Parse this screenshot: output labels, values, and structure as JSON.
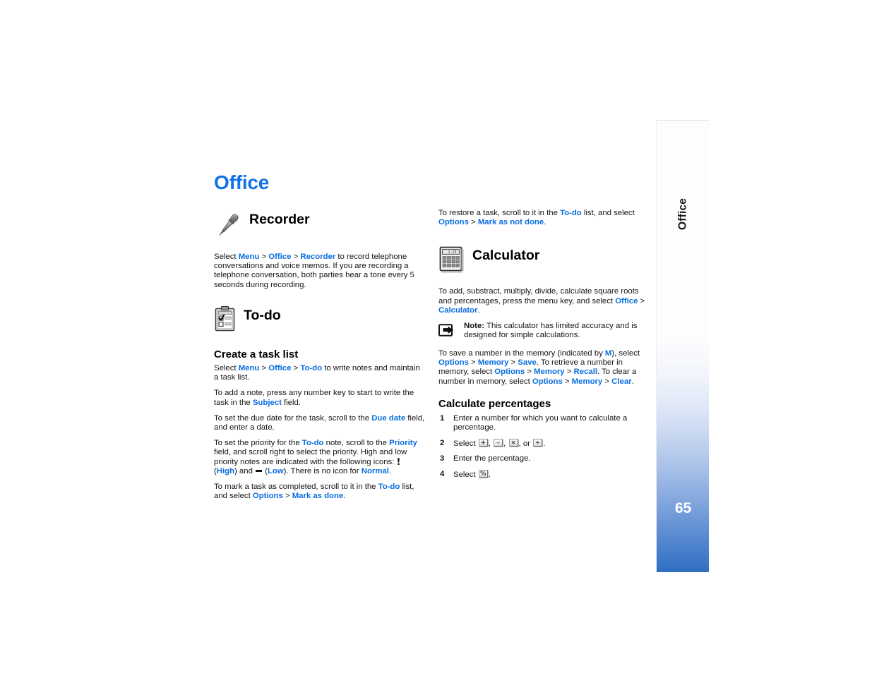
{
  "page": {
    "chapter_title": "Office",
    "side_tab_label": "Office",
    "page_number": "65",
    "accent_color": "#0a6ee1",
    "tab_gradient_end": "#2e6fc2"
  },
  "left_column": {
    "recorder": {
      "icon": "microphone-icon",
      "title": "Recorder",
      "paragraph_parts": {
        "p1_a": "Select ",
        "p1_menu": "Menu",
        "p1_gt1": " > ",
        "p1_office": "Office",
        "p1_gt2": " > ",
        "p1_recorder": "Recorder",
        "p1_b": " to record telephone conversations and voice memos. If you are recording a telephone conversation, both parties hear a tone every 5 seconds during recording."
      }
    },
    "todo": {
      "icon": "clipboard-checklist-icon",
      "title": "To-do",
      "subhead": "Create a task list",
      "p1": {
        "a": "Select ",
        "menu": "Menu",
        "gt1": " > ",
        "office": "Office",
        "gt2": " > ",
        "todo": "To-do",
        "b": " to write notes and maintain a task list."
      },
      "p2": {
        "a": "To add a note, press any number key to start to write the task in the ",
        "subject": "Subject",
        "b": " field."
      },
      "p3": {
        "a": "To set the due date for the task, scroll to the ",
        "duedate": "Due date",
        "b": " field, and enter a date."
      },
      "p4": {
        "a": "To set the priority for the ",
        "todo": "To-do",
        "b": " note, scroll to the ",
        "priority": "Priority",
        "c": " field, and scroll right to select the priority. High and low priority notes are indicated with the following icons: ",
        "high_icon": "!",
        "d": " (",
        "high": "High",
        "e": ") and ",
        "low_icon": "—",
        "f": " (",
        "low": "Low",
        "g": "). There is no icon for ",
        "normal": "Normal",
        "h": "."
      },
      "p5": {
        "a": "To mark a task as completed, scroll to it in the ",
        "todo": "To-do",
        "b": " list, and select ",
        "options": "Options",
        "gt": " > ",
        "markdone": "Mark as done",
        "c": "."
      }
    }
  },
  "right_column": {
    "restore": {
      "a": "To restore a task, scroll to it in the ",
      "todo": "To-do",
      "b": " list, and select ",
      "options": "Options",
      "gt": " > ",
      "marknotdone": "Mark as not done",
      "c": "."
    },
    "calculator": {
      "icon": "calculator-icon",
      "title": "Calculator",
      "p1": {
        "a": "To add, substract, multiply, divide, calculate square roots and percentages, press the menu key, and select ",
        "office": "Office",
        "gt": " > ",
        "calculator": "Calculator",
        "b": "."
      },
      "note": {
        "icon": "note-arrow-icon",
        "label": "Note:",
        "text": " This calculator has limited accuracy and is designed for simple calculations."
      },
      "memory": {
        "a": "To save a number in the memory (indicated by ",
        "m": "M",
        "b": "), select ",
        "options1": "Options",
        "gt1": " > ",
        "memory1": "Memory",
        "gt2": " > ",
        "save": "Save",
        "c": ". To retrieve a number in memory, select ",
        "options2": "Options",
        "gt3": " > ",
        "memory2": "Memory",
        "gt4": " > ",
        "recall": "Recall",
        "d": ". To clear a number in memory, select ",
        "options3": "Options",
        "gt5": " > ",
        "memory3": "Memory",
        "gt6": " > ",
        "clear": "Clear",
        "e": "."
      },
      "percent_head": "Calculate percentages",
      "steps": [
        {
          "num": "1",
          "text": "Enter a number for which you want to calculate a percentage."
        },
        {
          "num": "2",
          "prefix": "Select ",
          "keys": [
            "+",
            "–",
            "×",
            "÷"
          ],
          "joiner": ", ",
          "last_joiner": ", or ",
          "suffix": "."
        },
        {
          "num": "3",
          "text": "Enter the percentage."
        },
        {
          "num": "4",
          "prefix": "Select ",
          "keys": [
            "%"
          ],
          "suffix": "."
        }
      ]
    }
  }
}
